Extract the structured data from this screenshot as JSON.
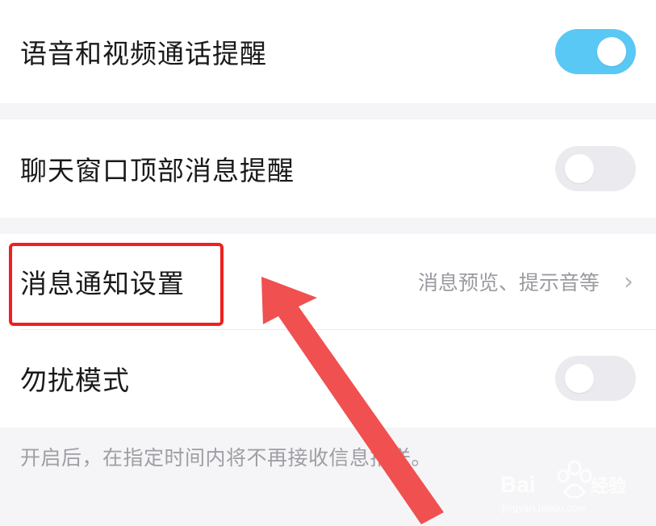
{
  "settings": {
    "items": [
      {
        "label": "语音和视频通话提醒",
        "toggle": "on"
      },
      {
        "label": "聊天窗口顶部消息提醒",
        "toggle": "off"
      },
      {
        "label": "消息通知设置",
        "detail": "消息预览、提示音等",
        "chevron": "›"
      },
      {
        "label": "勿扰模式",
        "toggle": "off"
      }
    ],
    "dnd_note": "开启后，在指定时间内将不再接收信息推送。"
  },
  "annotation": {
    "highlight_color": "#ee2020",
    "arrow_color": "#f05050"
  },
  "watermark": {
    "brand": "Baidu经验",
    "url": "jingyan.baidu.com"
  },
  "colors": {
    "toggle_on": "#5ac8f5",
    "toggle_off": "#ebebef",
    "background": "#f5f5f7"
  }
}
